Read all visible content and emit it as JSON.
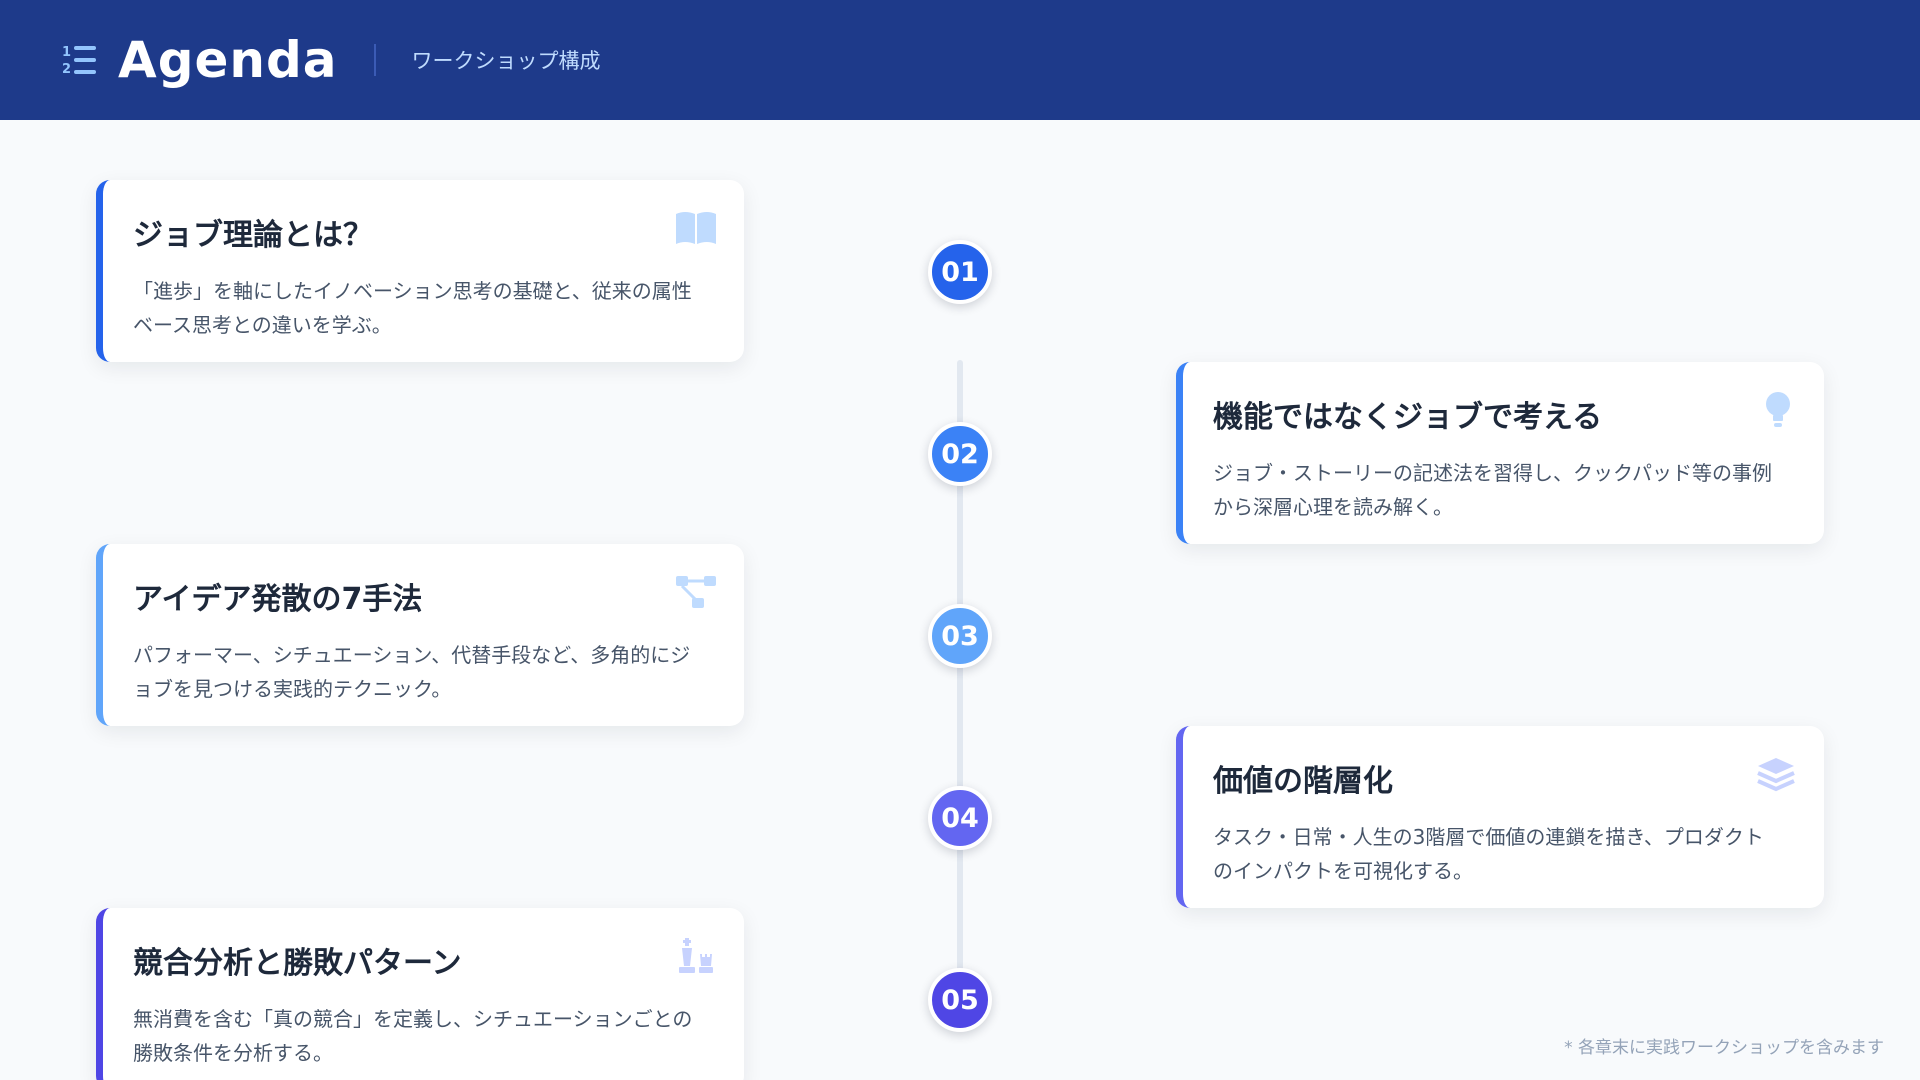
{
  "header": {
    "title": "Agenda",
    "subtitle": "ワークショップ構成",
    "icon": "numbered-list-icon"
  },
  "sections": [
    {
      "number": "01",
      "title": "ジョブ理論とは？",
      "description": "「進歩」を軸にしたイノベーション思考の基礎と、従来の属性ベース思考との違いを学ぶ。",
      "icon": "book-icon",
      "color": "#2563eb"
    },
    {
      "number": "02",
      "title": "機能ではなくジョブで考える",
      "description": "ジョブ・ストーリーの記述法を習得し、クックパッド等の事例から深層心理を読み解く。",
      "icon": "lightbulb-icon",
      "color": "#3b82f6"
    },
    {
      "number": "03",
      "title": "アイデア発散の7手法",
      "description": "パフォーマー、シチュエーション、代替手段など、多角的にジョブを見つける実践的テクニック。",
      "icon": "sitemap-icon",
      "color": "#60a5fa"
    },
    {
      "number": "04",
      "title": "価値の階層化",
      "description": "タスク・日常・人生の3階層で価値の連鎖を描き、プロダクトのインパクトを可視化する。",
      "icon": "layers-icon",
      "color": "#6366f1"
    },
    {
      "number": "05",
      "title": "競合分析と勝敗パターン",
      "description": "無消費を含む「真の競合」を定義し、シチュエーションごとの勝敗条件を分析する。",
      "icon": "chess-icon",
      "color": "#4f46e5"
    }
  ],
  "footnote": "* 各章末に実践ワークショップを含みます"
}
